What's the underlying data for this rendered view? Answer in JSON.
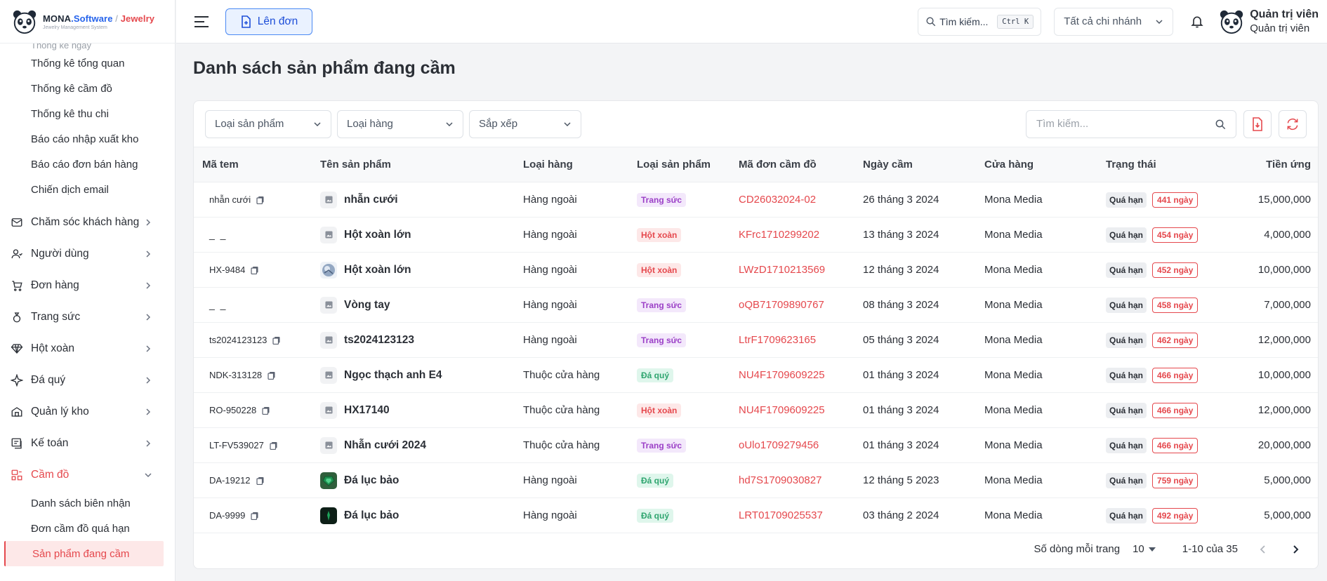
{
  "brand": {
    "name_part1": "MONA",
    "name_part2": ".Software",
    "separator": " / ",
    "name_part3": "Jewelry",
    "tagline": "Jewelry Management System"
  },
  "sidebar": {
    "cut_item": "Thống kê ngày",
    "sub_top": [
      {
        "label": "Thống kê tổng quan"
      },
      {
        "label": "Thống kê cầm đồ"
      },
      {
        "label": "Thống kê thu chi"
      },
      {
        "label": "Báo cáo nhập xuất kho"
      },
      {
        "label": "Báo cáo đơn bán hàng"
      },
      {
        "label": "Chiến dịch email"
      }
    ],
    "main": [
      {
        "label": "Chăm sóc khách hàng",
        "icon": "mail-icon"
      },
      {
        "label": "Người dùng",
        "icon": "user-icon"
      },
      {
        "label": "Đơn hàng",
        "icon": "cart-icon"
      },
      {
        "label": "Trang sức",
        "icon": "ring-icon"
      },
      {
        "label": "Hột xoàn",
        "icon": "diamond-icon"
      },
      {
        "label": "Đá quý",
        "icon": "sparkle-icon"
      },
      {
        "label": "Quản lý kho",
        "icon": "warehouse-icon"
      },
      {
        "label": "Kế toán",
        "icon": "accounting-icon"
      },
      {
        "label": "Cầm đồ",
        "icon": "pawn-icon"
      }
    ],
    "sub_pawn": [
      {
        "label": "Danh sách biên nhận"
      },
      {
        "label": "Đơn cầm đồ quá hạn"
      },
      {
        "label": "Sản phẩm đang cầm"
      }
    ]
  },
  "header": {
    "create_label": "Lên đơn",
    "search_label": "Tìm kiếm...",
    "search_shortcut": "Ctrl K",
    "branch": "Tất cả chi nhánh",
    "user_name": "Quản trị viên",
    "user_role": "Quản trị viên"
  },
  "page": {
    "title": "Danh sách sản phẩm đang cầm"
  },
  "filters": {
    "product_type": "Loại sản phẩm",
    "goods_type": "Loại hàng",
    "sort": "Sắp xếp",
    "search_placeholder": "Tìm kiếm..."
  },
  "table": {
    "columns": [
      "Mã tem",
      "Tên sản phẩm",
      "Loại hàng",
      "Loại sản phẩm",
      "Mã đơn cầm đồ",
      "Ngày cầm",
      "Cửa hàng",
      "Trạng thái",
      "Tiền ứng"
    ],
    "rows": [
      {
        "code": "nhẫn cưới",
        "name": "nhẫn cưới",
        "goods": "Hàng ngoài",
        "ptype": "Trang sức",
        "tag": "ts",
        "order": "CD26032024-02",
        "date": "26 tháng 3 2024",
        "store": "Mona Media",
        "status": "Quá hạn",
        "days": "441 ngày",
        "amount": "15,000,000",
        "thumb": "placeholder"
      },
      {
        "code": "_ _",
        "name": "Hột xoàn lớn",
        "goods": "Hàng ngoài",
        "ptype": "Hột xoàn",
        "tag": "hx",
        "order": "KFrc1710299202",
        "date": "13 tháng 3 2024",
        "store": "Mona Media",
        "status": "Quá hạn",
        "days": "454 ngày",
        "amount": "4,000,000",
        "thumb": "placeholder"
      },
      {
        "code": "HX-9484",
        "name": "Hột xoàn lớn",
        "goods": "Hàng ngoài",
        "ptype": "Hột xoàn",
        "tag": "hx",
        "order": "LWzD1710213569",
        "date": "12 tháng 3 2024",
        "store": "Mona Media",
        "status": "Quá hạn",
        "days": "452 ngày",
        "amount": "10,000,000",
        "thumb": "globe"
      },
      {
        "code": "_ _",
        "name": "Vòng tay",
        "goods": "Hàng ngoài",
        "ptype": "Trang sức",
        "tag": "ts",
        "order": "oQB71709890767",
        "date": "08 tháng 3 2024",
        "store": "Mona Media",
        "status": "Quá hạn",
        "days": "458 ngày",
        "amount": "7,000,000",
        "thumb": "placeholder"
      },
      {
        "code": "ts2024123123",
        "name": "ts2024123123",
        "goods": "Hàng ngoài",
        "ptype": "Trang sức",
        "tag": "ts",
        "order": "LtrF1709623165",
        "date": "05 tháng 3 2024",
        "store": "Mona Media",
        "status": "Quá hạn",
        "days": "462 ngày",
        "amount": "12,000,000",
        "thumb": "placeholder"
      },
      {
        "code": "NDK-313128",
        "name": "Ngọc thạch anh E4",
        "goods": "Thuộc cửa hàng",
        "ptype": "Đá quý",
        "tag": "dq",
        "order": "NU4F1709609225",
        "date": "01 tháng 3 2024",
        "store": "Mona Media",
        "status": "Quá hạn",
        "days": "466 ngày",
        "amount": "10,000,000",
        "thumb": "placeholder"
      },
      {
        "code": "RO-950228",
        "name": "HX17140",
        "goods": "Thuộc cửa hàng",
        "ptype": "Hột xoàn",
        "tag": "hx",
        "order": "NU4F1709609225",
        "date": "01 tháng 3 2024",
        "store": "Mona Media",
        "status": "Quá hạn",
        "days": "466 ngày",
        "amount": "12,000,000",
        "thumb": "placeholder"
      },
      {
        "code": "LT-FV539027",
        "name": "Nhẫn cưới 2024",
        "goods": "Thuộc cửa hàng",
        "ptype": "Trang sức",
        "tag": "ts",
        "order": "oUlo1709279456",
        "date": "01 tháng 3 2024",
        "store": "Mona Media",
        "status": "Quá hạn",
        "days": "466 ngày",
        "amount": "20,000,000",
        "thumb": "placeholder"
      },
      {
        "code": "DA-19212",
        "name": "Đá lục bảo",
        "goods": "Hàng ngoài",
        "ptype": "Đá quý",
        "tag": "dq",
        "order": "hd7S1709030827",
        "date": "12 tháng 5 2023",
        "store": "Mona Media",
        "status": "Quá hạn",
        "days": "759 ngày",
        "amount": "5,000,000",
        "thumb": "emerald"
      },
      {
        "code": "DA-9999",
        "name": "Đá lục bảo",
        "goods": "Hàng ngoài",
        "ptype": "Đá quý",
        "tag": "dq",
        "order": "LRT01709025537",
        "date": "03 tháng 2 2024",
        "store": "Mona Media",
        "status": "Quá hạn",
        "days": "492 ngày",
        "amount": "5,000,000",
        "thumb": "dark"
      }
    ]
  },
  "pagination": {
    "rows_per_page_label": "Số dòng mỗi trang",
    "rows_per_page": "10",
    "range": "1-10 của 35"
  },
  "colors": {
    "accent_red": "#e5484d",
    "primary_blue": "#2563eb"
  }
}
